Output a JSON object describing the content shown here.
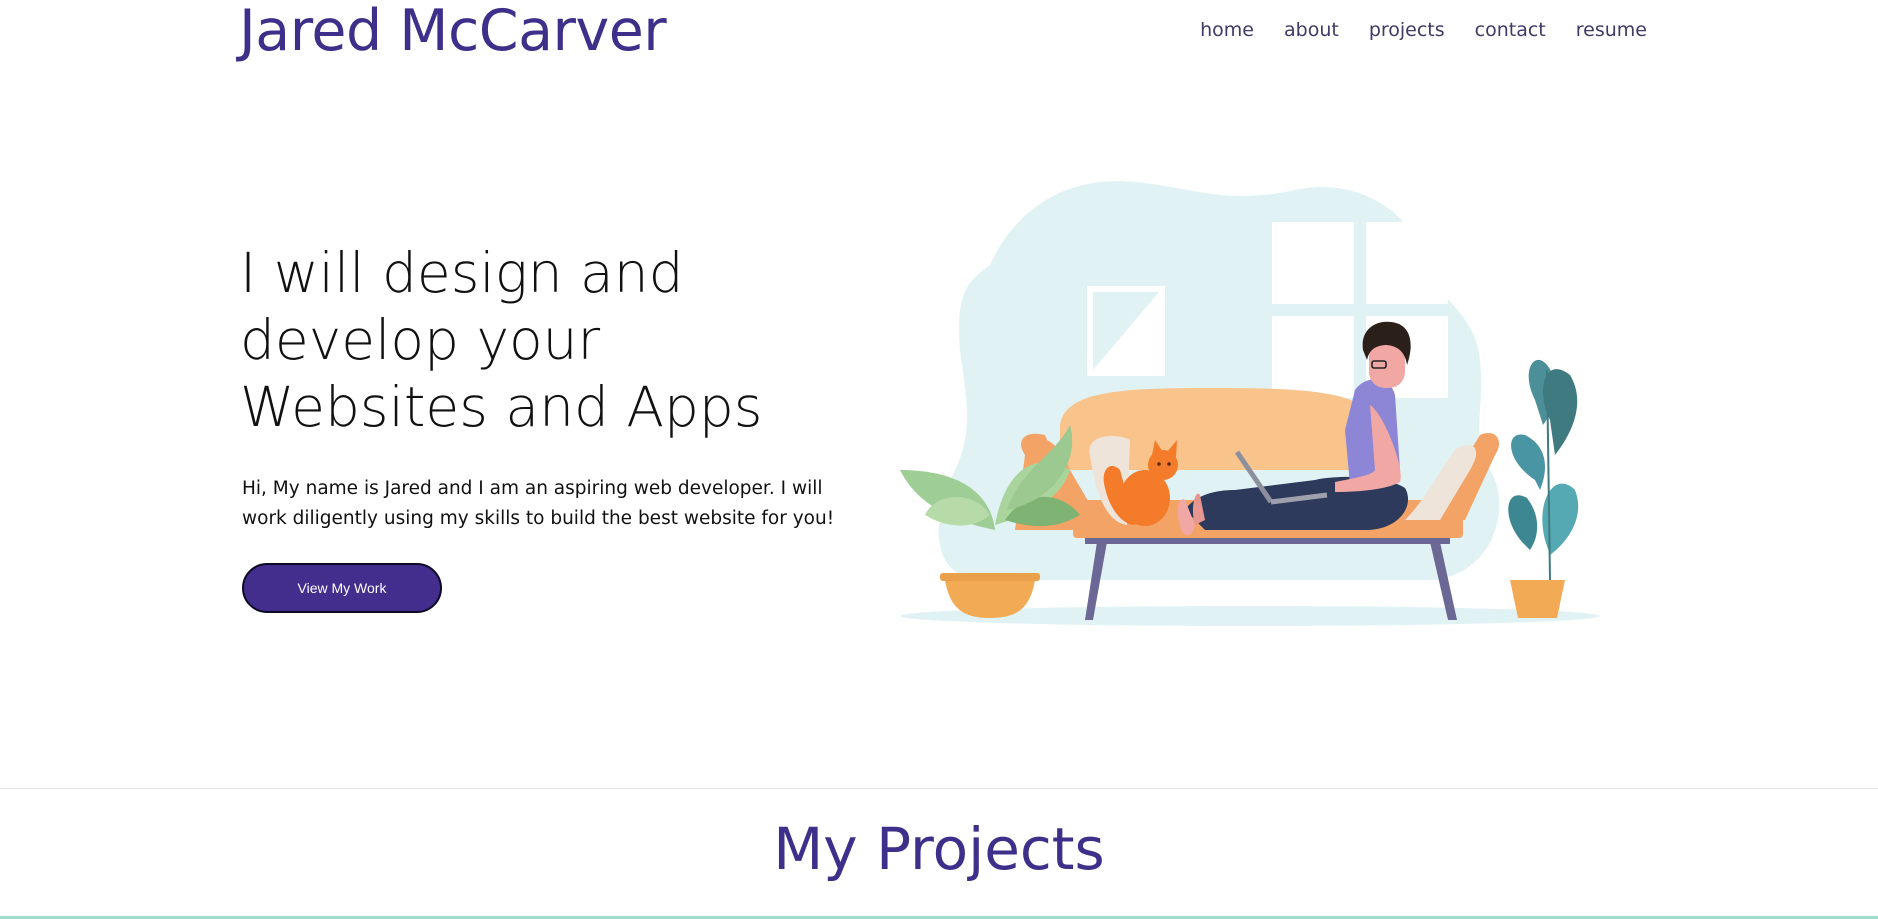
{
  "header": {
    "logo": "Jared McCarver",
    "nav": [
      "home",
      "about",
      "projects",
      "contact",
      "resume"
    ]
  },
  "hero": {
    "heading_lines": [
      "I will design and",
      "develop your",
      "Websites and Apps"
    ],
    "text_lines": [
      "Hi, My name is Jared and I am an aspiring web developer. I will",
      "work diligently using my skills to build the best website for you!"
    ],
    "cta_label": "View My Work"
  },
  "projects": {
    "title": "My Projects"
  },
  "colors": {
    "brand": "#3d2f8a",
    "button": "#432e8e",
    "accent_line": "#9fdcc9"
  },
  "illustration": "person-on-sofa-with-laptop-and-cat-illustration"
}
